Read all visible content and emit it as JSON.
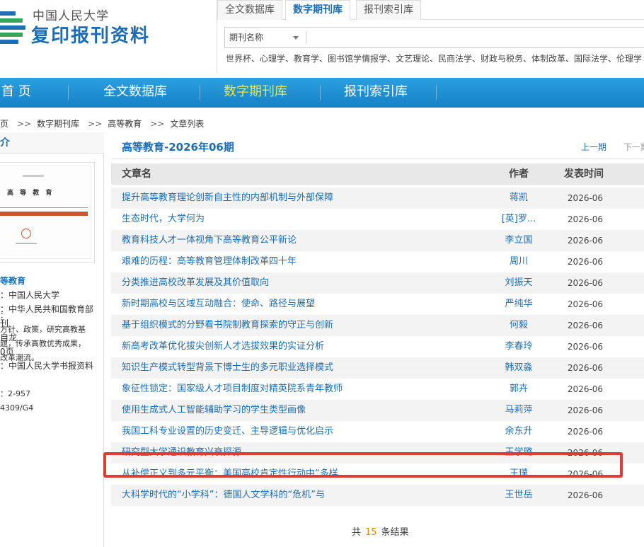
{
  "header": {
    "logo_line1": "中国人民大学",
    "logo_line2": "复印报刊资料",
    "search_tabs": [
      "全文数据库",
      "数字期刊库",
      "报刊索引库"
    ],
    "active_tab": "数字期刊库",
    "search_field_label": "期刊名称",
    "hot_words": "世界杯、心理学、教育学、图书馆学情报学、文艺理论、民商法学、财政与税务、体制改革、国际法学、伦理学"
  },
  "nav": {
    "items": [
      "首 页",
      "全文数据库",
      "数字期刊库",
      "报刊索引库"
    ],
    "active": "数字期刊库"
  },
  "breadcrumb": [
    "页",
    "数字期刊库",
    "高等教育",
    "文章列表"
  ],
  "breadcrumb_sep": ">>",
  "sidebar": {
    "header": "介",
    "cover_title": "高 等 教 育",
    "info_lines": [
      "等教育",
      "：中国人民大学",
      "：中华人民共和国教育部",
      "刊",
      "自龙",
      "0页",
      "：中国人民大学书报资料",
      "",
      "：2-957",
      "4309/G4"
    ],
    "desc_lines": [
      "：",
      "方针、政策，研究高教基",
      "题，传承高教优秀成果，",
      "改革潮流。"
    ]
  },
  "content": {
    "issue_title": "高等教育-2026年06期",
    "prev_label": "上一期",
    "next_label": "下一期",
    "columns": [
      "文章名",
      "作者",
      "发表时间"
    ],
    "articles": [
      {
        "title": "提升高等教育理论创新自主性的内部机制与外部保障",
        "author": "蒋凯",
        "date": "2026-06"
      },
      {
        "title": "生态时代，大学何为",
        "author": "[英]罗...",
        "date": "2026-06"
      },
      {
        "title": "教育科技人才一体视角下高等教育公平新论",
        "author": "李立国",
        "date": "2026-06"
      },
      {
        "title": "艰难的历程：高等教育管理体制改革四十年",
        "author": "周川",
        "date": "2026-06"
      },
      {
        "title": "分类推进高校改革发展及其价值取向",
        "author": "刘振天",
        "date": "2026-06"
      },
      {
        "title": "新时期高校与区域互动融合：使命、路径与展望",
        "author": "严纯华",
        "date": "2026-06"
      },
      {
        "title": "基于组织模式的分野看书院制教育探索的守正与创新",
        "author": "何毅",
        "date": "2026-06"
      },
      {
        "title": "新高考改革优化拔尖创新人才选拔效果的实证分析",
        "author": "李春玲",
        "date": "2026-06"
      },
      {
        "title": "知识生产模式转型背景下博士生的多元职业选择模式",
        "author": "韩双淼",
        "date": "2026-06"
      },
      {
        "title": "象征性锁定：国家级人才项目制度对精英院系青年教师",
        "author": "郭卉",
        "date": "2026-06"
      },
      {
        "title": "使用生成式人工智能辅助学习的学生类型画像",
        "author": "马莉萍",
        "date": "2026-06"
      },
      {
        "title": "我国工科专业设置的历史变迁、主导逻辑与优化启示",
        "author": "余东升",
        "date": "2026-06"
      },
      {
        "title": "研究型大学通识教育兴衰探源",
        "author": "王学璐",
        "date": "2026-06"
      },
      {
        "title": "从补偿正义到多元平衡：美国高校肯定性行动中“多样",
        "author": "王璞",
        "date": "2026-06"
      },
      {
        "title": "大科学时代的“小学科”：德国人文学科的“危机”与",
        "author": "王世岳",
        "date": "2026-06"
      }
    ],
    "total_prefix": "共",
    "total_count": "15",
    "total_suffix": "条结果",
    "highlight_color": "#e23a34"
  }
}
